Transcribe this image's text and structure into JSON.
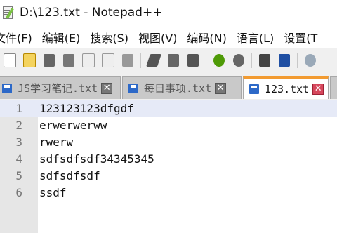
{
  "window": {
    "title": "D:\\123.txt - Notepad++"
  },
  "menu": {
    "items": [
      "文件(F)",
      "编辑(E)",
      "搜索(S)",
      "视图(V)",
      "编码(N)",
      "语言(L)",
      "设置(T"
    ]
  },
  "toolbar": {
    "icons": [
      "new-file-icon",
      "open-file-icon",
      "save-icon",
      "save-all-icon",
      "close-icon",
      "close-all-icon",
      "print-icon",
      "cut-icon",
      "copy-icon",
      "paste-icon",
      "undo-icon",
      "redo-icon",
      "find-icon",
      "replace-icon",
      "zoom-in-icon"
    ]
  },
  "tabs": [
    {
      "label": "JS学习笔记.txt",
      "active": false,
      "close": "✕"
    },
    {
      "label": "每日事项.txt",
      "active": false,
      "close": "✕"
    },
    {
      "label": "123.txt",
      "active": true,
      "close": "✕"
    }
  ],
  "editor": {
    "current_line": 1,
    "lines": [
      {
        "number": "1",
        "text": "123123123dfgdf"
      },
      {
        "number": "2",
        "text": "erwerwerww"
      },
      {
        "number": "3",
        "text": "rwerw"
      },
      {
        "number": "4",
        "text": "sdfsdfsdf34345345"
      },
      {
        "number": "5",
        "text": "sdfsdfsdf"
      },
      {
        "number": "6",
        "text": "ssdf"
      }
    ]
  },
  "colors": {
    "current_line": "#e6eaf7",
    "active_tab_accent": "#f29b31",
    "tab_icon": "#2d69c8"
  }
}
